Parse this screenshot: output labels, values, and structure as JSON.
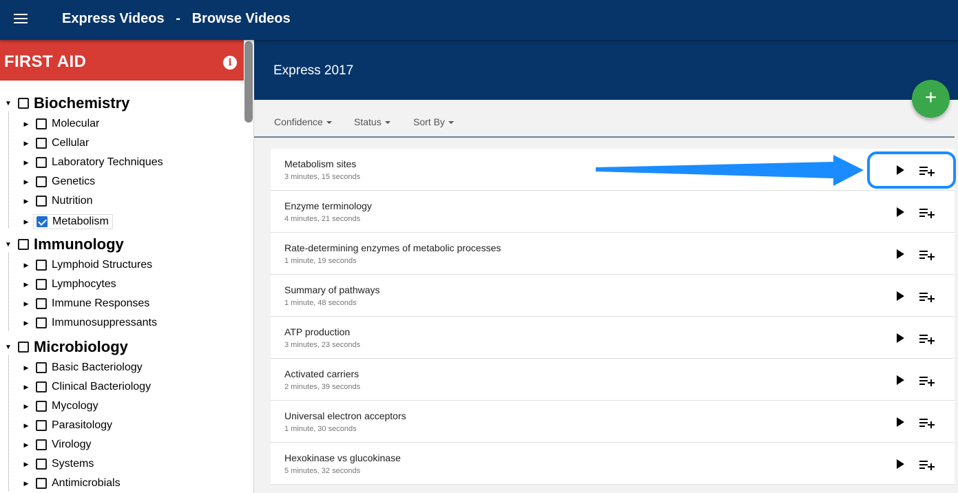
{
  "appbar": {
    "title": "Express Videos   -   Browse Videos"
  },
  "sidebar": {
    "header_title": "FIRST AID",
    "subjects": [
      {
        "label": "Biochemistry",
        "checked": false,
        "topics": [
          {
            "label": "Molecular",
            "checked": false
          },
          {
            "label": "Cellular",
            "checked": false
          },
          {
            "label": "Laboratory Techniques",
            "checked": false
          },
          {
            "label": "Genetics",
            "checked": false
          },
          {
            "label": "Nutrition",
            "checked": false
          },
          {
            "label": "Metabolism",
            "checked": true
          }
        ]
      },
      {
        "label": "Immunology",
        "checked": false,
        "topics": [
          {
            "label": "Lymphoid Structures",
            "checked": false
          },
          {
            "label": "Lymphocytes",
            "checked": false
          },
          {
            "label": "Immune Responses",
            "checked": false
          },
          {
            "label": "Immunosuppressants",
            "checked": false
          }
        ]
      },
      {
        "label": "Microbiology",
        "checked": false,
        "topics": [
          {
            "label": "Basic Bacteriology",
            "checked": false
          },
          {
            "label": "Clinical Bacteriology",
            "checked": false
          },
          {
            "label": "Mycology",
            "checked": false
          },
          {
            "label": "Parasitology",
            "checked": false
          },
          {
            "label": "Virology",
            "checked": false
          },
          {
            "label": "Systems",
            "checked": false
          },
          {
            "label": "Antimicrobials",
            "checked": false
          }
        ]
      }
    ]
  },
  "main": {
    "title": "Express 2017",
    "filters": [
      {
        "label": "Confidence"
      },
      {
        "label": "Status"
      },
      {
        "label": "Sort By"
      }
    ],
    "videos": [
      {
        "title": "Metabolism sites",
        "duration": "3 minutes, 15 seconds"
      },
      {
        "title": "Enzyme terminology",
        "duration": "4 minutes, 21 seconds"
      },
      {
        "title": "Rate-determining enzymes of metabolic processes",
        "duration": "1 minute, 19 seconds"
      },
      {
        "title": "Summary of pathways",
        "duration": "1 minute, 48 seconds"
      },
      {
        "title": "ATP production",
        "duration": "3 minutes, 23 seconds"
      },
      {
        "title": "Activated carriers",
        "duration": "2 minutes, 39 seconds"
      },
      {
        "title": "Universal electron acceptors",
        "duration": "1 minute, 30 seconds"
      },
      {
        "title": "Hexokinase vs glucokinase",
        "duration": "5 minutes, 32 seconds"
      }
    ]
  },
  "colors": {
    "appbar": "#07356a",
    "first_aid_header": "#d63b34",
    "fab": "#3aa84a",
    "checkbox_checked": "#1f6fd1",
    "annotation": "#1a8cff"
  },
  "icons": {
    "menu": "menu-icon",
    "info": "info-icon",
    "add": "plus-icon",
    "play": "play-icon",
    "queue": "playlist-add-icon"
  }
}
